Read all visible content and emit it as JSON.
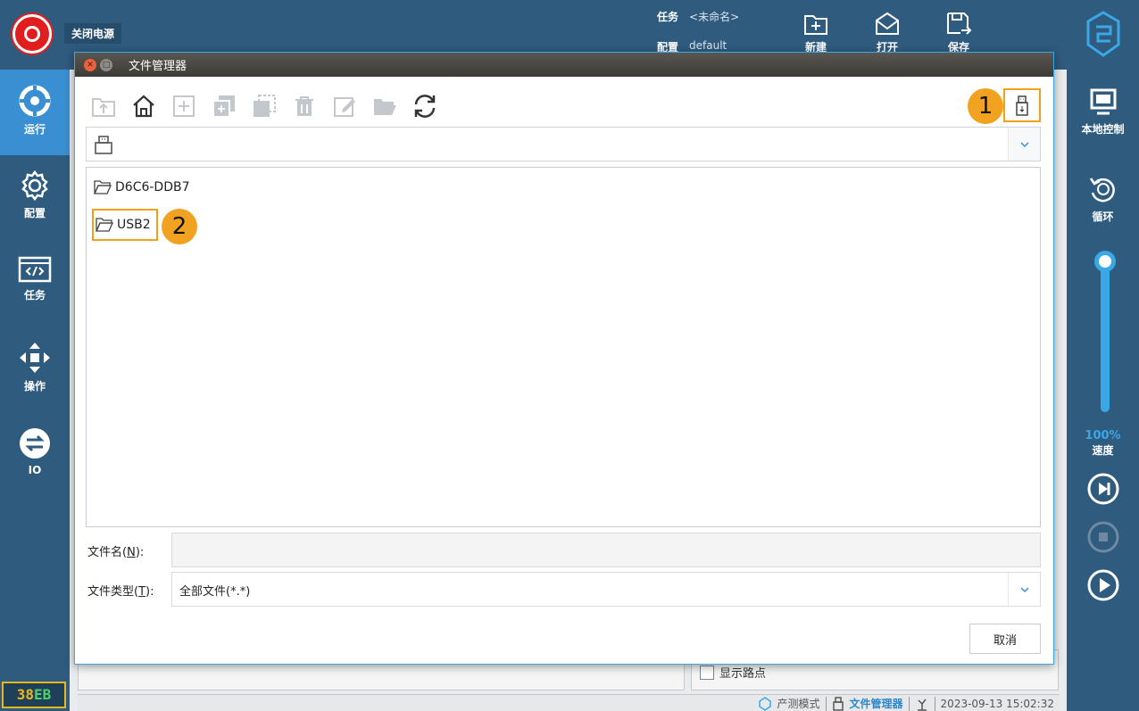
{
  "topbar": {
    "power_label": "关闭电源",
    "task_key": "任务",
    "task_value": "<未命名>",
    "config_key": "配置",
    "config_value": "default",
    "new_label": "新建",
    "open_label": "打开",
    "save_label": "保存"
  },
  "sidebar": {
    "items": [
      {
        "label": "运行",
        "icon": "run-icon"
      },
      {
        "label": "配置",
        "icon": "gear-icon"
      },
      {
        "label": "任务",
        "icon": "code-icon"
      },
      {
        "label": "操作",
        "icon": "move-arrows-icon"
      },
      {
        "label": "IO",
        "icon": "io-icon"
      }
    ],
    "device_tag_a": "38",
    "device_tag_b": "EB"
  },
  "rightbar": {
    "local_control": "本地控制",
    "loop": "循环",
    "speed_value": "100%",
    "speed_fraction": 1.0,
    "speed_label": "速度"
  },
  "background": {
    "show_path_label": "显示路点",
    "status_mode": "产测模式",
    "status_filemgr": "文件管理器",
    "status_datetime": "2023-09-13 15:02:32"
  },
  "dialog": {
    "title": "文件管理器",
    "badge_1": "1",
    "badge_2": "2",
    "files": [
      {
        "name": "D6C6-DDB7"
      },
      {
        "name": "USB2"
      }
    ],
    "filename_label_pre": "文件名(",
    "filename_label_key": "N",
    "filename_label_post": "):",
    "filename_value": "",
    "filetype_label_pre": "文件类型(",
    "filetype_label_key": "T",
    "filetype_label_post": "):",
    "filetype_value": "全部文件(*.*)",
    "cancel_label": "取消"
  },
  "colors": {
    "accent": "#3a8fd2",
    "highlight": "#f0a019",
    "power": "#e01e1e",
    "chrome": "#2f5b7e"
  }
}
